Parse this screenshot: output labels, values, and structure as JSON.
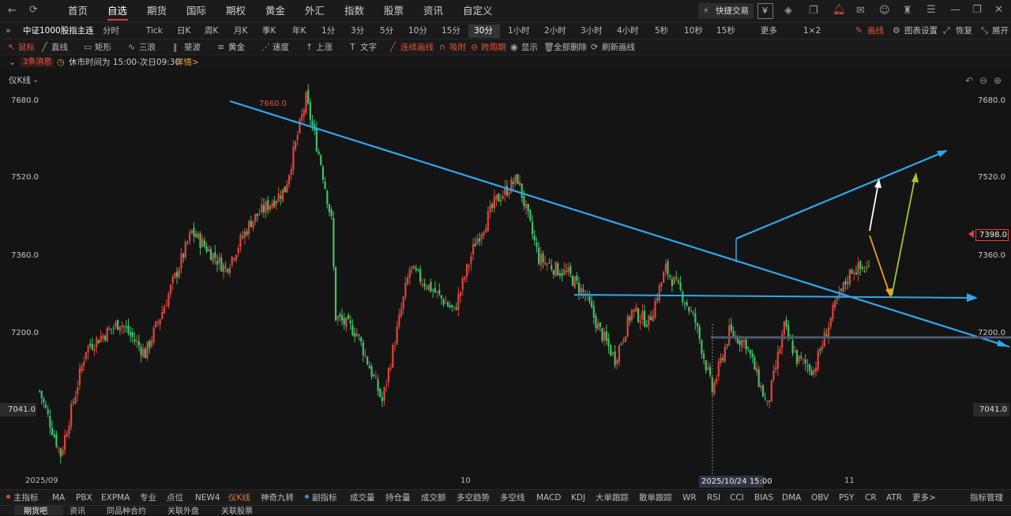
{
  "topnav": {
    "items": [
      "首页",
      "自选",
      "期货",
      "国际",
      "期权",
      "黄金",
      "外汇",
      "指数",
      "股票",
      "资讯",
      "自定义"
    ],
    "active_index": 1,
    "quick_trade": "快捷交易",
    "yen_icon": "¥"
  },
  "toolbar": {
    "symbol": "中证1000股指主连",
    "timeframes": [
      "分时",
      "Tick",
      "日K",
      "周K",
      "月K",
      "季K",
      "年K",
      "1分",
      "3分",
      "5分",
      "10分",
      "15分",
      "30分",
      "1小时",
      "2小时",
      "3小时",
      "4小时",
      "5秒",
      "10秒",
      "15秒",
      "更多",
      "1×2"
    ],
    "active_timeframe": "30分",
    "draw_label": "画线",
    "chart_settings_label": "图表设置",
    "restore_label": "恢复",
    "expand_label": "展开"
  },
  "drawbar": {
    "items": [
      "鼠标",
      "直线",
      "矩形",
      "三浪",
      "斐波",
      "黄金",
      "速度",
      "上涨",
      "文字",
      "连续画线",
      "吸附",
      "跨周期",
      "显示",
      "全部删除",
      "刷新画线"
    ]
  },
  "infobar": {
    "news_badge": "3条消息",
    "session_text": "休市时间为 15:00-次日09:30",
    "detail_link": "详情>"
  },
  "chart": {
    "indicator_label": "仪K线",
    "price_labels": [
      "7680.0",
      "7520.0",
      "7360.0",
      "7200.0",
      "7041.0"
    ],
    "current_price": "7398.0",
    "left_price_tag": "7041.0",
    "right_price_tag": "7041.0",
    "peak_label": "7660.0",
    "x_labels": [
      "2025/09",
      "10",
      "11"
    ],
    "crosshair_time": "2025/10/24 15:00"
  },
  "chart_data": {
    "type": "candlestick",
    "y_range": [
      6940,
      7700
    ],
    "y_ticks": [
      7680,
      7520,
      7360,
      7200,
      7041
    ],
    "x_tick_labels": [
      "2025/09",
      "10",
      "11"
    ],
    "last_price": 7398.0,
    "peak": 7660.0,
    "colors": {
      "up": "#e0453a",
      "down": "#3ec36a",
      "trendline": "#2ea8f0"
    },
    "path_anchors": [
      [
        0,
        7100
      ],
      [
        10,
        6980
      ],
      [
        22,
        7180
      ],
      [
        38,
        7230
      ],
      [
        50,
        7170
      ],
      [
        58,
        7250
      ],
      [
        72,
        7400
      ],
      [
        88,
        7330
      ],
      [
        100,
        7420
      ],
      [
        116,
        7480
      ],
      [
        126,
        7650
      ],
      [
        133,
        7530
      ],
      [
        138,
        7420
      ],
      [
        140,
        7240
      ],
      [
        150,
        7210
      ],
      [
        162,
        7080
      ],
      [
        175,
        7330
      ],
      [
        186,
        7290
      ],
      [
        196,
        7250
      ],
      [
        206,
        7380
      ],
      [
        216,
        7460
      ],
      [
        226,
        7500
      ],
      [
        236,
        7350
      ],
      [
        244,
        7330
      ],
      [
        250,
        7320
      ],
      [
        258,
        7280
      ],
      [
        264,
        7220
      ],
      [
        272,
        7160
      ],
      [
        280,
        7250
      ],
      [
        288,
        7230
      ],
      [
        296,
        7330
      ],
      [
        304,
        7280
      ],
      [
        310,
        7230
      ],
      [
        318,
        7100
      ],
      [
        326,
        7210
      ],
      [
        334,
        7190
      ],
      [
        344,
        7070
      ],
      [
        352,
        7220
      ],
      [
        358,
        7160
      ],
      [
        366,
        7140
      ],
      [
        376,
        7260
      ],
      [
        384,
        7330
      ],
      [
        392,
        7330
      ]
    ]
  },
  "indicators": {
    "main_label": "主指标",
    "main": [
      "MA",
      "PBX",
      "EXPMA",
      "专业",
      "点位",
      "NEW4",
      "仪K线",
      "神奇九转"
    ],
    "sub_label": "副指标",
    "sub": [
      "成交量",
      "持仓量",
      "成交额",
      "多空趋势",
      "多空线",
      "MACD",
      "KDJ",
      "大单跟踪",
      "散单跟踪",
      "WR",
      "RSI",
      "CCI",
      "BIAS",
      "DMA",
      "OBV",
      "PSY",
      "CR",
      "ATR",
      "更多>"
    ],
    "manage": "指标管理"
  },
  "bottom_tabs": [
    "期货吧",
    "资讯",
    "同品种合约",
    "关联外盘",
    "关联股票"
  ]
}
